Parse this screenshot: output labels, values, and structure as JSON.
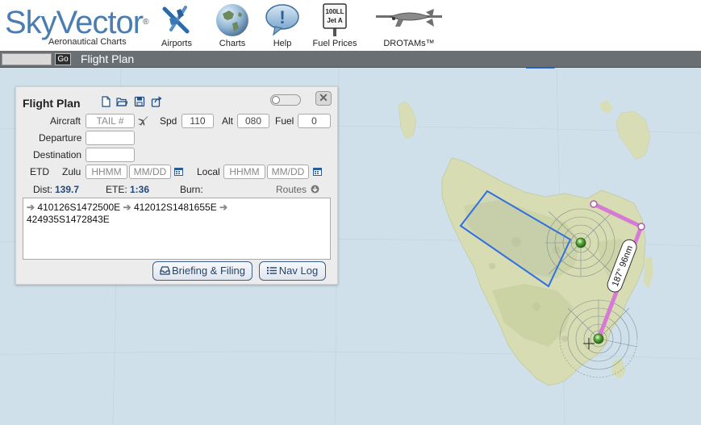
{
  "header": {
    "logo_text": "SkyVector",
    "logo_reg": "®",
    "logo_subtitle": "Aeronautical Charts",
    "nav": [
      {
        "label": "Airports",
        "icon": "airport-icon"
      },
      {
        "label": "Charts",
        "icon": "globe-icon"
      },
      {
        "label": "Help",
        "icon": "help-icon"
      },
      {
        "label": "Fuel Prices",
        "icon": "fuel-sign-icon",
        "sign_line1": "100LL",
        "sign_line2": "Jet A"
      },
      {
        "label": "DROTAMs™",
        "icon": "drone-icon"
      }
    ]
  },
  "toolbar": {
    "search_value": "",
    "go_label": "Go",
    "title": "Flight Plan"
  },
  "panel": {
    "title": "Flight Plan",
    "aircraft_label": "Aircraft",
    "aircraft_placeholder": "TAIL #",
    "spd_label": "Spd",
    "spd_value": "110",
    "alt_label": "Alt",
    "alt_value": "080",
    "fuel_label": "Fuel",
    "fuel_value": "0",
    "departure_label": "Departure",
    "destination_label": "Destination",
    "etd_label": "ETD",
    "zulu_label": "Zulu",
    "zulu_time_placeholder": "HHMM",
    "zulu_date_placeholder": "MM/DD",
    "local_label": "Local",
    "local_time_placeholder": "HHMM",
    "local_date_placeholder": "MM/DD",
    "dist_label": "Dist:",
    "dist_value": "139.7",
    "ete_label": "ETE:",
    "ete_value": "1:36",
    "burn_label": "Burn:",
    "routes_label": "Routes",
    "route_waypoints": [
      "410126S1472500E",
      "412012S1481655E",
      "424935S1472843E"
    ],
    "briefing_label": "Briefing & Filing",
    "navlog_label": "Nav Log"
  },
  "map": {
    "leg_label": "187° 96nm",
    "route_color": "#d67ad6",
    "box_color": "#2f6fe0",
    "water_color": "#cfe0ea",
    "land_color": "#d6dcb0"
  }
}
